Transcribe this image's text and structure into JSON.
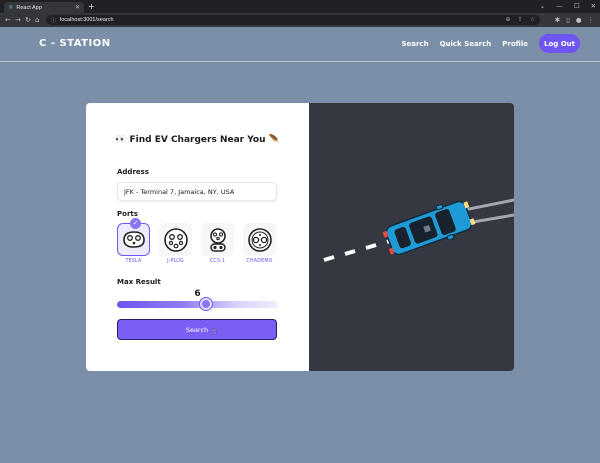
{
  "browser": {
    "tab_title": "React App",
    "url": "localhost:3001/search",
    "new_tab_icon": "plus-icon"
  },
  "header": {
    "brand": "C - STATION",
    "nav": [
      "Search",
      "Quick Search",
      "Profile"
    ],
    "logout_label": "Log Out"
  },
  "form": {
    "title": "👀 Find EV Chargers Near You 🪶",
    "address_label": "Address",
    "address_value": "JFK - Terminal 7, Jamaica, NY, USA",
    "ports_label": "Ports",
    "ports": [
      {
        "name": "TESLA",
        "selected": true
      },
      {
        "name": "J-PLUG",
        "selected": false
      },
      {
        "name": "CCS-1",
        "selected": false
      },
      {
        "name": "CHADEMO",
        "selected": false
      }
    ],
    "max_result_label": "Max Result",
    "max_result_value": "6",
    "slider_fraction": 0.55,
    "search_label": "Search"
  },
  "colors": {
    "accent": "#6f55f2",
    "background": "#7b8fa9",
    "scene": "#353841",
    "car": "#1e9bd6"
  }
}
